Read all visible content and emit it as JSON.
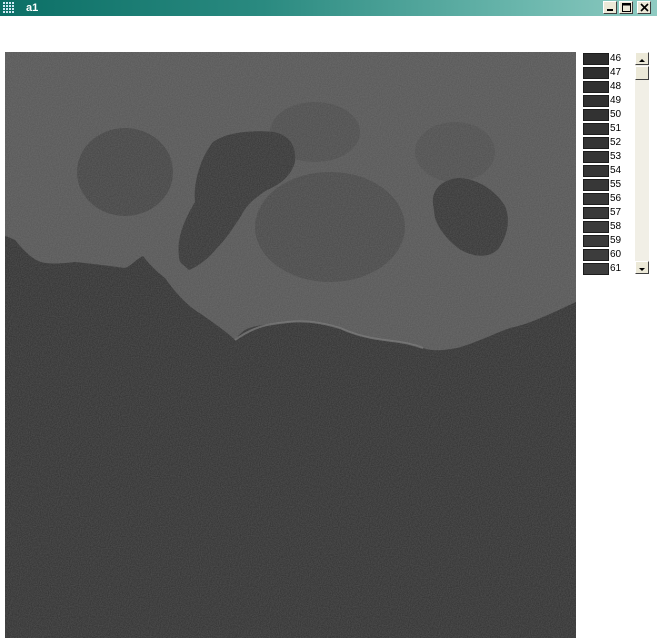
{
  "window": {
    "title": "a1"
  },
  "icons": {
    "app": "grid-icon",
    "minimize": "minimize-icon",
    "maximize": "maximize-icon",
    "close": "close-icon"
  },
  "colors": {
    "titlebar": "#0b6f66",
    "water": "#2f2f2f",
    "land": "#555555"
  },
  "legend": {
    "items": [
      {
        "label": "46",
        "color": "#2e2e2e"
      },
      {
        "label": "47",
        "color": "#2f2f2f"
      },
      {
        "label": "48",
        "color": "#303030"
      },
      {
        "label": "49",
        "color": "#313131"
      },
      {
        "label": "50",
        "color": "#323232"
      },
      {
        "label": "51",
        "color": "#333333"
      },
      {
        "label": "52",
        "color": "#343434"
      },
      {
        "label": "53",
        "color": "#353535"
      },
      {
        "label": "54",
        "color": "#363636"
      },
      {
        "label": "55",
        "color": "#373737"
      },
      {
        "label": "56",
        "color": "#383838"
      },
      {
        "label": "57",
        "color": "#393939"
      },
      {
        "label": "58",
        "color": "#3a3a3a"
      },
      {
        "label": "59",
        "color": "#3b3b3b"
      },
      {
        "label": "60",
        "color": "#3c3c3c"
      },
      {
        "label": "61",
        "color": "#3d3d3d"
      }
    ]
  }
}
